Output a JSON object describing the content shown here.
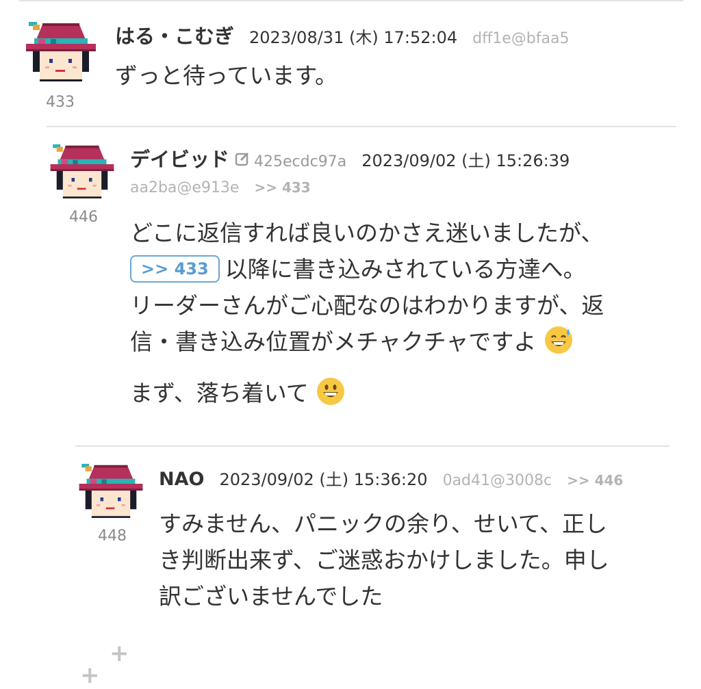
{
  "posts": [
    {
      "name": "はる・こむぎ",
      "datetime": "2023/08/31 (木) 17:52:04",
      "hash": "dff1e@bfaa5",
      "number": "433",
      "lines": [
        "ずっと待っています。"
      ]
    },
    {
      "name": "デイビッド",
      "edit_icon": "edit-square-icon",
      "id_code": "425ecdc97a",
      "datetime": "2023/09/02 (土) 15:26:39",
      "hash": "aa2ba@e913e",
      "reply_to": ">> 433",
      "number": "446",
      "lines": [
        "どこに返信すれば良いのかさえ迷いましたが、",
        "以降に書き込みされている方達へ。",
        "リーダーさんがご心配なのはわかりますが、返",
        "信・書き込み位置がメチャクチャですよ",
        "まず、落ち着いて"
      ],
      "anchor_button": ">> 433",
      "emojis": [
        "grinning-sweat-emoji",
        "grinning-face-emoji"
      ]
    },
    {
      "name": "NAO",
      "datetime": "2023/09/02 (土) 15:36:20",
      "hash": "0ad41@3008c",
      "reply_to": ">> 446",
      "number": "448",
      "lines": [
        "すみません、パニックの余り、せいて、正し",
        "き判断出来ず、ご迷惑おかけしました。申し",
        "訳ございませんでした"
      ]
    }
  ],
  "colors": {
    "anchor": "#5a9bd1",
    "muted": "#b3b3b3",
    "divider": "#e3e3e3",
    "hat": "#b5305a",
    "band": "#2ab3b8"
  },
  "footer_icon": "add-plus-icon"
}
